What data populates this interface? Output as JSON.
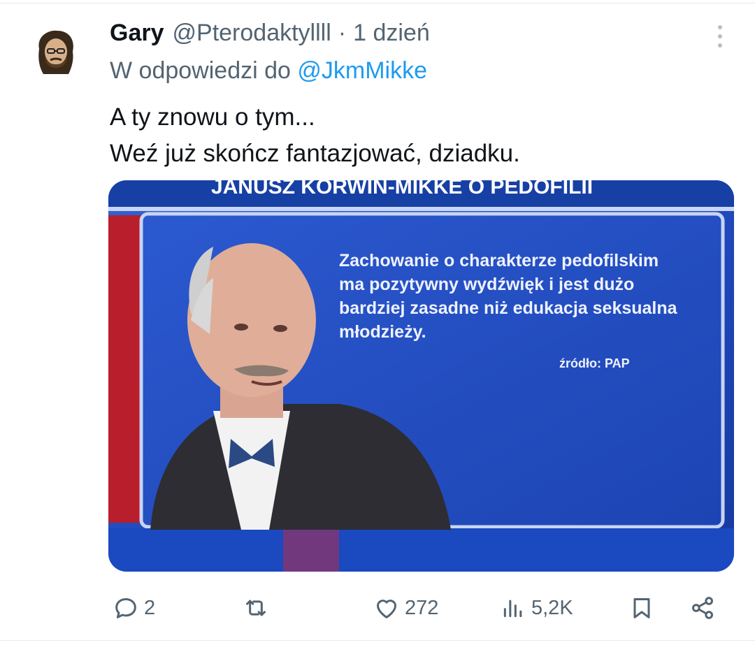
{
  "tweet": {
    "author_name": "Gary",
    "author_handle": "@Pterodaktyllll",
    "separator": "·",
    "timestamp": "1 dzień",
    "reply_prefix": "W odpowiedzi do",
    "reply_to": "@JkmMikke",
    "text_lines": [
      "A ty znowu o tym...",
      "Weź już skończ fantazjować, dziadku."
    ]
  },
  "media": {
    "headline": "JANUSZ KORWIN-MIKKE O PEDOFILII",
    "quote_lines": [
      "Zachowanie o charakterze pedofilskim",
      "ma pozytywny wydźwięk i jest dużo",
      "bardziej zasadne niż edukacja seksualna",
      "młodzieży."
    ],
    "source": "źródło: PAP"
  },
  "actions": {
    "replies": "2",
    "reposts": "",
    "likes": "272",
    "views": "5,2K"
  },
  "icons": {
    "more": "more-vertical-icon",
    "reply": "reply-icon",
    "repost": "repost-icon",
    "like": "heart-icon",
    "views": "views-icon",
    "bookmark": "bookmark-icon",
    "share": "share-icon"
  },
  "colors": {
    "text_primary": "#0f1419",
    "text_secondary": "#536471",
    "link": "#1d9bf0",
    "divider": "#e7e9ea",
    "media_blue": "#2a55c8"
  }
}
